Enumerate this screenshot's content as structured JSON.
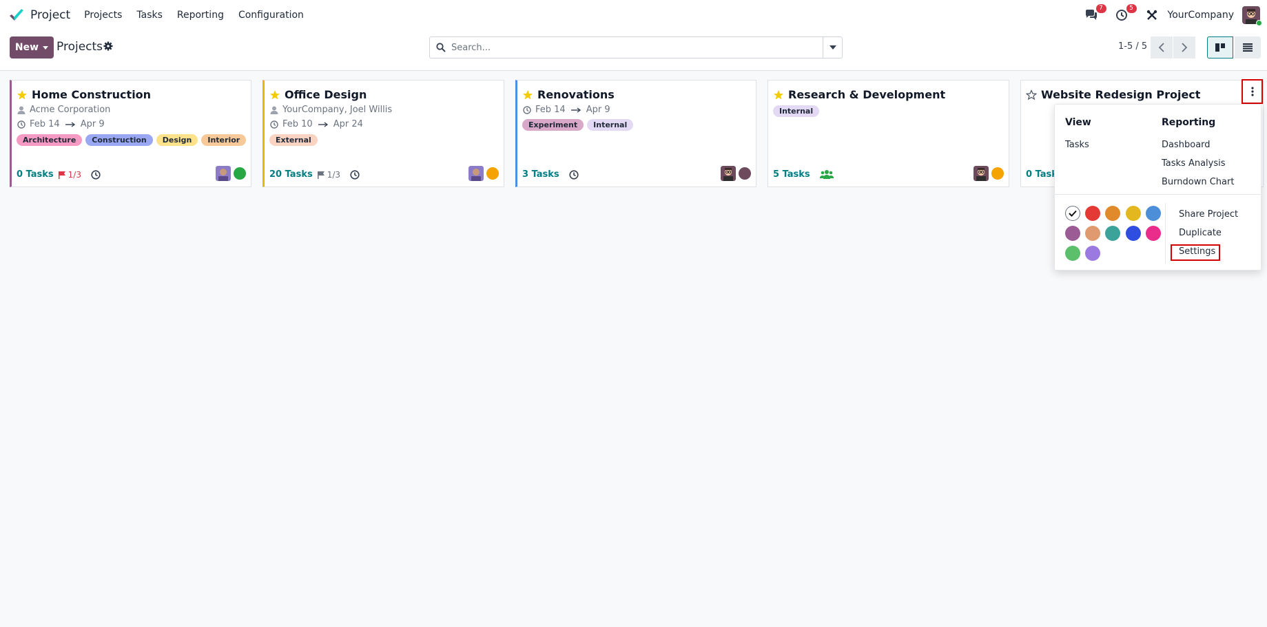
{
  "navbar": {
    "app_name": "Project",
    "menu": [
      "Projects",
      "Tasks",
      "Reporting",
      "Configuration"
    ],
    "messages_badge": "7",
    "activities_badge": "5",
    "company": "YourCompany",
    "icons": [
      "project-app-logo",
      "chat-icon",
      "clock-icon",
      "tools-icon",
      "user-avatar"
    ]
  },
  "control_panel": {
    "new_label": "New",
    "title": "Projects",
    "search_placeholder": "Search...",
    "pager": "1-5 / 5"
  },
  "colors": {
    "primary": "#714b67",
    "link": "#017e84",
    "highlight": "#d50000"
  },
  "cards": [
    {
      "title": "Home Construction",
      "customer": "Acme Corporation",
      "date_start": "Feb 14",
      "date_end": "Apr 9",
      "tags": [
        "Architecture",
        "Construction",
        "Design",
        "Interior"
      ],
      "tasks": "0 Tasks",
      "milestones": "1/3",
      "favorite": true,
      "accent": "#9b5b95"
    },
    {
      "title": "Office Design",
      "customer": "YourCompany, Joel Willis",
      "date_start": "Feb 10",
      "date_end": "Apr 24",
      "tags": [
        "External"
      ],
      "tasks": "20 Tasks",
      "milestones": "1/3",
      "favorite": true,
      "accent": "#f0b400"
    },
    {
      "title": "Renovations",
      "date_start": "Feb 14",
      "date_end": "Apr 9",
      "tags": [
        "Experiment",
        "Internal"
      ],
      "tasks": "3 Tasks",
      "favorite": true,
      "accent": "#4a90e2"
    },
    {
      "title": "Research & Development",
      "tags": [
        "Internal"
      ],
      "tasks": "5 Tasks",
      "favorite": true
    },
    {
      "title": "Website Redesign Project",
      "tasks": "0 Tasks",
      "favorite": false
    }
  ],
  "dropdown": {
    "view_header": "View",
    "view_items": [
      "Tasks"
    ],
    "reporting_header": "Reporting",
    "reporting_items": [
      "Dashboard",
      "Tasks Analysis",
      "Burndown Chart"
    ],
    "actions": [
      "Share Project",
      "Duplicate",
      "Settings"
    ],
    "color_swatches": [
      "#e53935",
      "#e08a2b",
      "#e3b81f",
      "#4c8fd8",
      "#9b5b95",
      "#e09a70",
      "#3ba39a",
      "#2f4de0",
      "#ea2c8a",
      "#5cbf6b",
      "#9a7ae0"
    ]
  }
}
